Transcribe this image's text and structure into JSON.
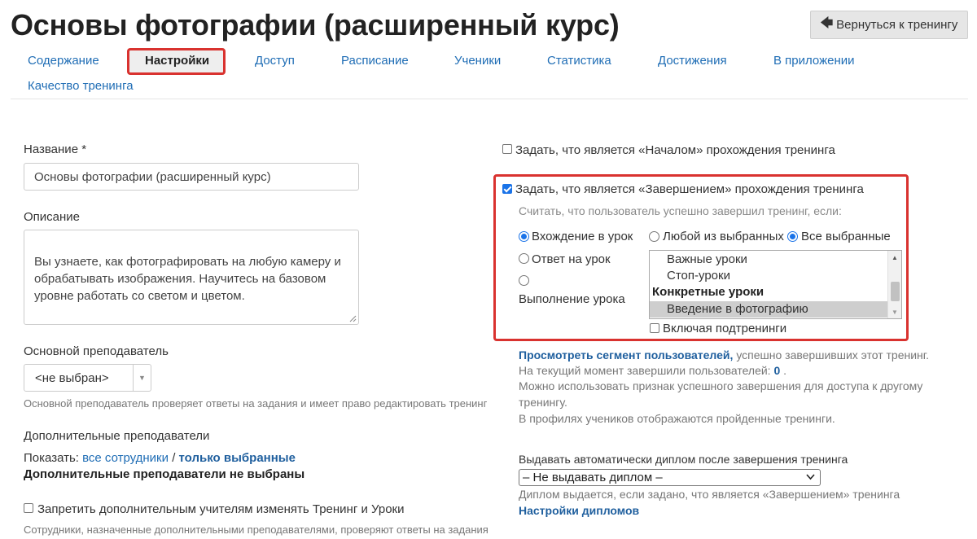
{
  "page": {
    "title": "Основы фотографии (расширенный курс)",
    "back_button": "Вернуться к тренингу",
    "accent_color": "#1f6db5",
    "highlight_color": "#d9322f"
  },
  "tabs": [
    {
      "label": "Содержание",
      "active": false
    },
    {
      "label": "Настройки",
      "active": true
    },
    {
      "label": "Доступ",
      "active": false
    },
    {
      "label": "Расписание",
      "active": false
    },
    {
      "label": "Ученики",
      "active": false
    },
    {
      "label": "Статистика",
      "active": false
    },
    {
      "label": "Достижения",
      "active": false
    },
    {
      "label": "В приложении",
      "active": false
    },
    {
      "label": "Качество тренинга",
      "active": false
    }
  ],
  "left": {
    "name_label": "Название *",
    "name_value": "Основы фотографии (расширенный курс)",
    "description_label": "Описание",
    "description_value": "Вы узнаете, как фотографировать на любую камеру и\nобрабатывать изображения. Научитесь на базовом\nуровне работать со светом и цветом.",
    "main_teacher_label": "Основной преподаватель",
    "main_teacher_value": "<не выбран>",
    "main_teacher_hint": "Основной преподаватель проверяет ответы на задания и имеет право редактировать тренинг",
    "extra_teachers_label": "Дополнительные преподаватели",
    "show_prefix": "Показать:",
    "show_all": "все сотрудники",
    "show_sep": "/",
    "show_selected": "только выбранные",
    "none_selected": "Дополнительные преподаватели не выбраны",
    "forbid_label": "Запретить дополнительным учителям изменять Тренинг и Уроки",
    "forbid_checked": false,
    "staff_hint": "Сотрудники, назначенные дополнительными преподавателями, проверяют ответы на задания"
  },
  "right": {
    "start_label": "Задать, что является «Началом» прохождения тренинга",
    "start_checked": false,
    "finish_label": "Задать, что является «Завершением» прохождения тренинга",
    "finish_checked": true,
    "consider_label": "Считать, что пользователь успешно завершил тренинг, если:",
    "criteria": [
      {
        "label": "Вхождение в урок",
        "checked": true
      },
      {
        "label": "Ответ на урок",
        "checked": false
      },
      {
        "label": "Выполнение урока",
        "checked": false
      }
    ],
    "mode": [
      {
        "label": "Любой из выбранных",
        "checked": false
      },
      {
        "label": "Все выбранные",
        "checked": true
      }
    ],
    "lesson_options": [
      {
        "label": "Важные уроки",
        "kind": "option",
        "selected": false
      },
      {
        "label": "Стоп-уроки",
        "kind": "option",
        "selected": false
      },
      {
        "label": "Конкретные уроки",
        "kind": "group",
        "selected": false
      },
      {
        "label": "Введение в фотографию",
        "kind": "option",
        "selected": true
      }
    ],
    "include_subtrainings": "Включая подтренинги",
    "include_checked": false,
    "segment_link": "Просмотреть сегмент пользователей,",
    "segment_rest": "успешно завершивших этот тренинг.",
    "completed_prefix": "На текущий момент завершили пользователей:",
    "completed_count": "0",
    "completed_suffix": ".",
    "access_hint_1": "Можно использовать признак успешного завершения для доступа к другому",
    "access_hint_2": "тренингу.",
    "profiles_hint": "В профилях учеников отображаются пройденные тренинги.",
    "diploma_label": "Выдавать автоматически диплом после завершения тренинга",
    "diploma_value": "– Не выдавать диплом –",
    "diploma_hint": "Диплом выдается, если задано, что является «Завершением» тренинга",
    "diploma_settings": "Настройки дипломов"
  }
}
